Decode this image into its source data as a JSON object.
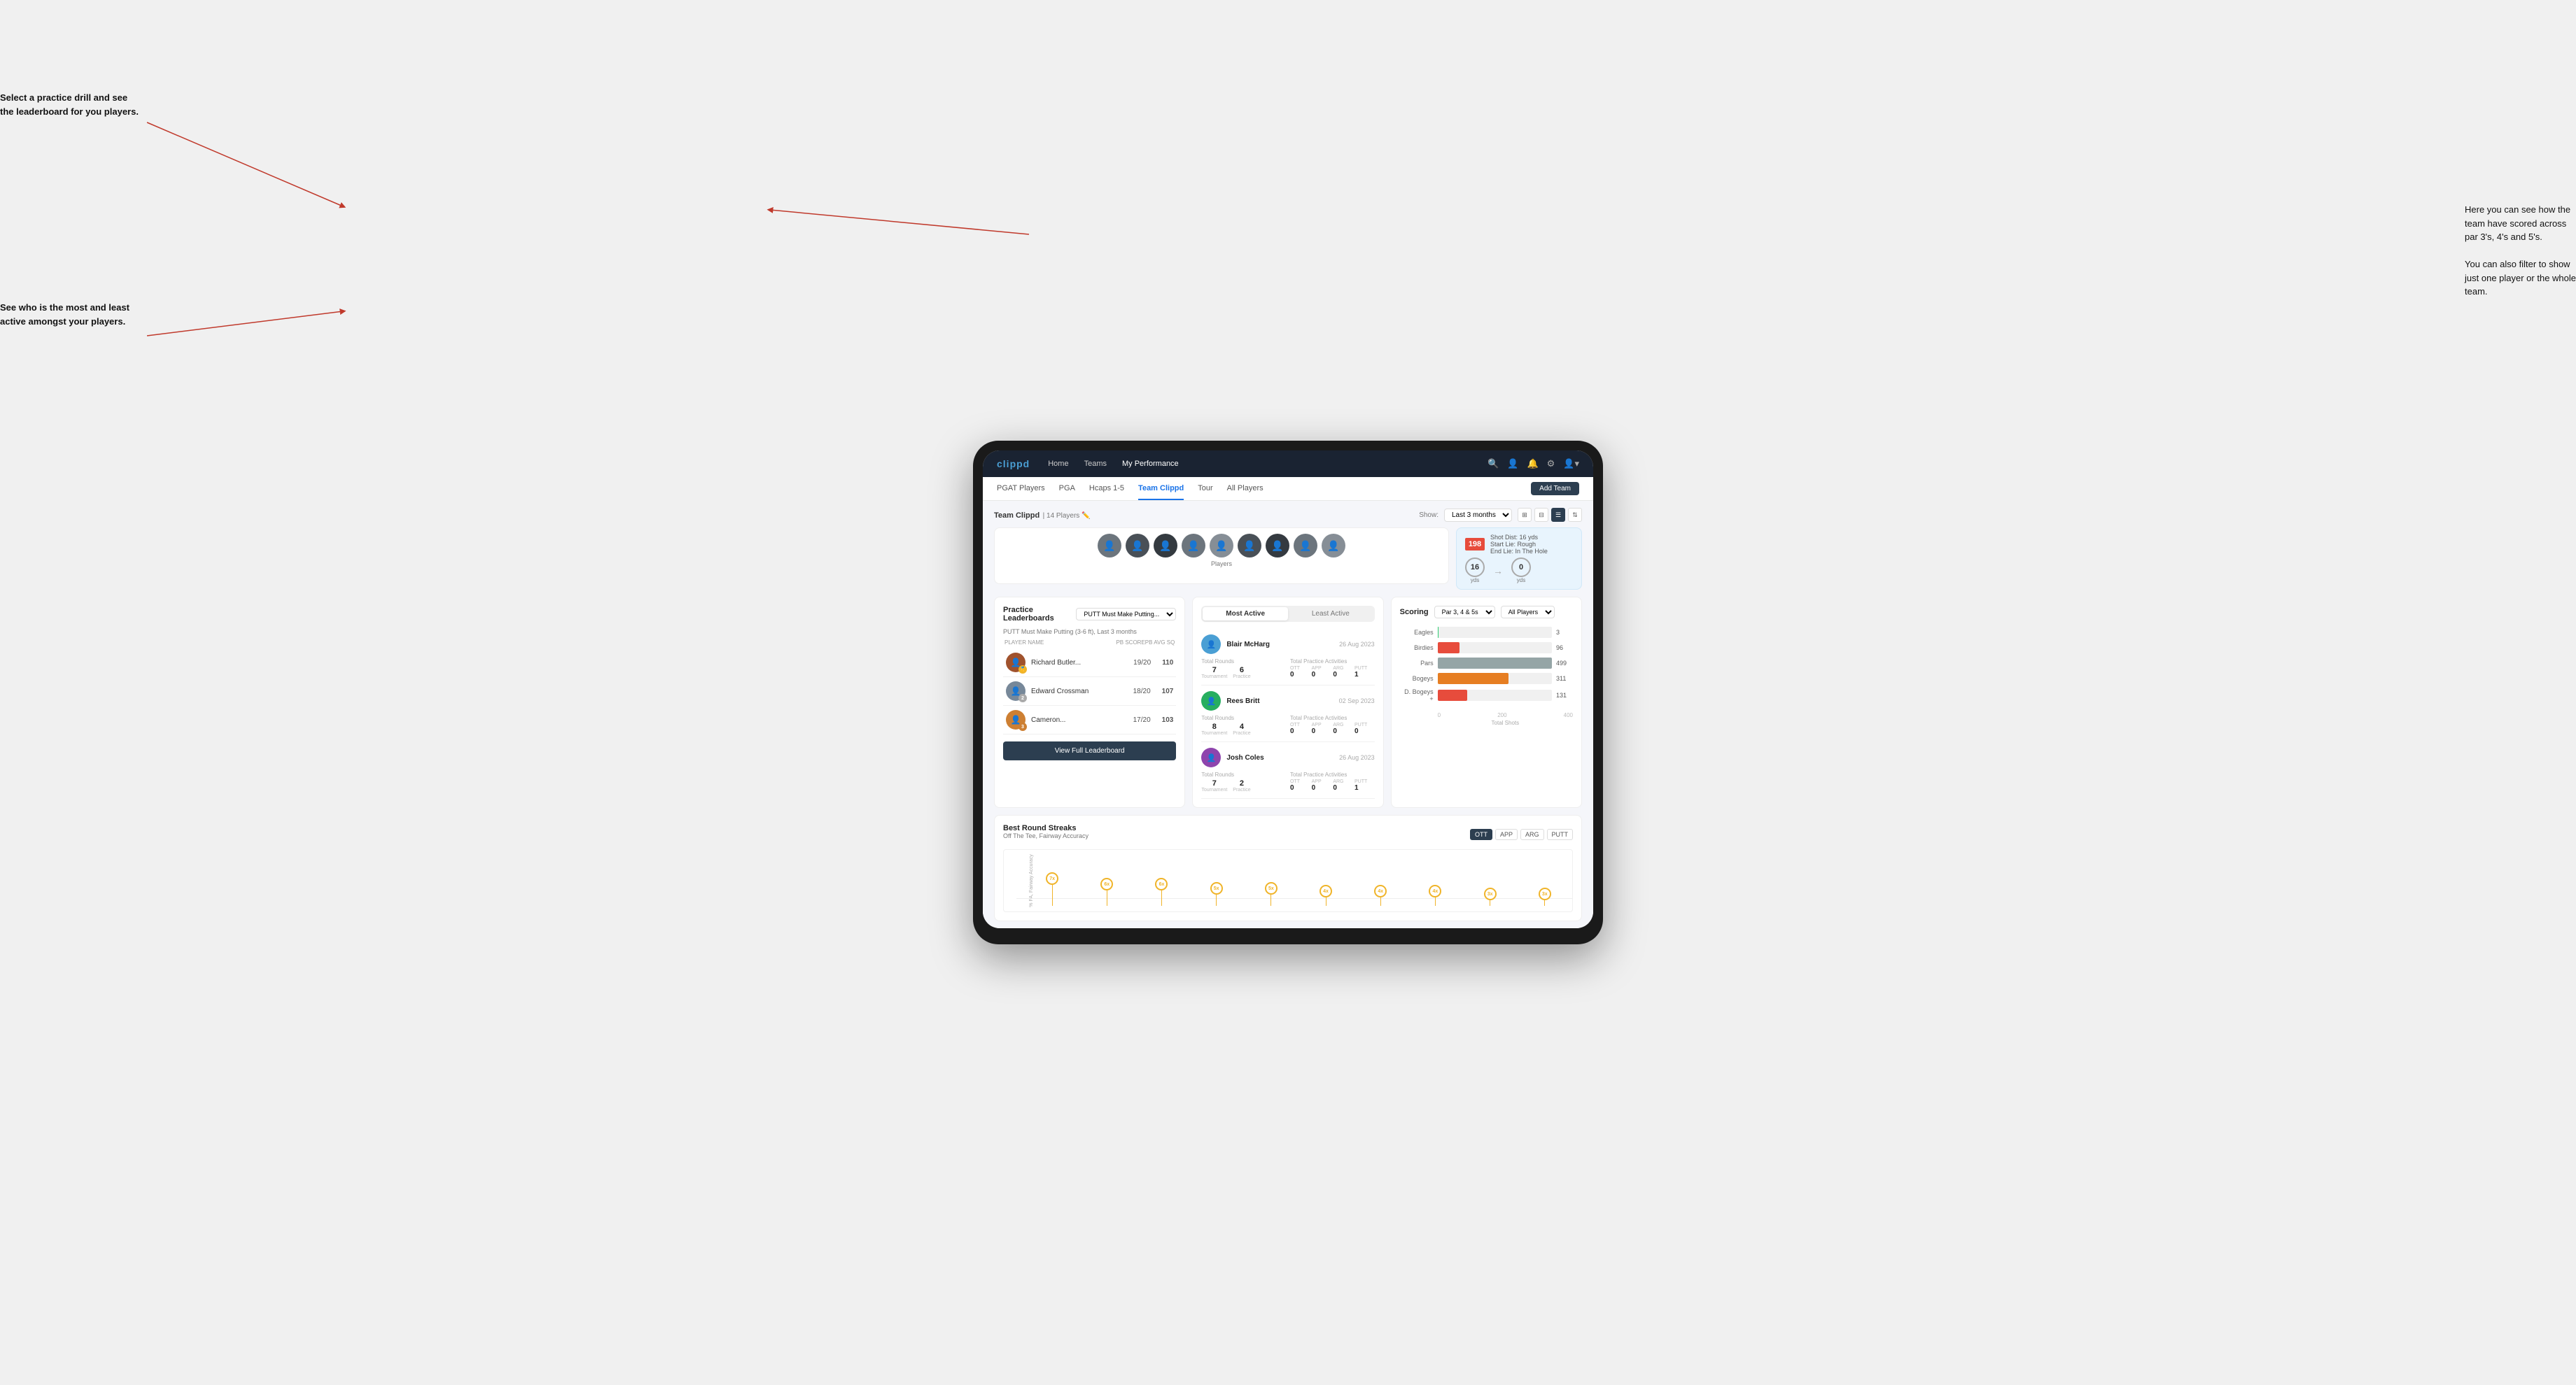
{
  "annotations": {
    "top_left": "Select a practice drill and see\nthe leaderboard for you players.",
    "bottom_left": "See who is the most and least\nactive amongst your players.",
    "top_right": "Here you can see how the\nteam have scored across\npar 3's, 4's and 5's.\n\nYou can also filter to show\njust one player or the whole\nteam."
  },
  "nav": {
    "logo": "clippd",
    "links": [
      "Home",
      "Teams",
      "My Performance"
    ],
    "icons": [
      "search",
      "person",
      "bell",
      "settings",
      "user"
    ]
  },
  "subnav": {
    "links": [
      "PGAT Players",
      "PGA",
      "Hcaps 1-5",
      "Team Clippd",
      "Tour",
      "All Players"
    ],
    "active": "Team Clippd",
    "add_team_label": "Add Team"
  },
  "team_header": {
    "title": "Team Clippd",
    "count": "14 Players",
    "show_label": "Show:",
    "show_value": "Last 3 months",
    "view_modes": [
      "grid-sm",
      "grid-lg",
      "list",
      "sort"
    ]
  },
  "players_label": "Players",
  "shot_info": {
    "dist_label": "Shot Dist: 16 yds",
    "start_label": "Start Lie: Rough",
    "end_label": "End Lie: In The Hole",
    "num": "198",
    "num_label": "SQ",
    "circle1_val": "16",
    "circle1_label": "yds",
    "circle2_val": "0",
    "circle2_label": "yds"
  },
  "practice_leaderboard": {
    "title": "Practice Leaderboards",
    "filter": "PUTT Must Make Putting...",
    "subtitle": "PUTT Must Make Putting (3-6 ft), Last 3 months",
    "col_name": "PLAYER NAME",
    "col_score": "PB SCORE",
    "col_avg": "PB AVG SQ",
    "players": [
      {
        "rank": 1,
        "name": "Richard Butler...",
        "score": "19/20",
        "avg": "110",
        "badge": "gold",
        "badge_num": ""
      },
      {
        "rank": 2,
        "name": "Edward Crossman",
        "score": "18/20",
        "avg": "107",
        "badge": "silver",
        "badge_num": "2"
      },
      {
        "rank": 3,
        "name": "Cameron...",
        "score": "17/20",
        "avg": "103",
        "badge": "bronze",
        "badge_num": "3"
      }
    ],
    "view_full_label": "View Full Leaderboard"
  },
  "active_players": {
    "tab_most": "Most Active",
    "tab_least": "Least Active",
    "active_tab": "most",
    "players": [
      {
        "name": "Blair McHarg",
        "date": "26 Aug 2023",
        "total_rounds_label": "Total Rounds",
        "tournament": "7",
        "tournament_label": "Tournament",
        "practice": "6",
        "practice_label": "Practice",
        "total_practice_label": "Total Practice Activities",
        "ott": "0",
        "app": "0",
        "arg": "0",
        "putt": "1"
      },
      {
        "name": "Rees Britt",
        "date": "02 Sep 2023",
        "total_rounds_label": "Total Rounds",
        "tournament": "8",
        "tournament_label": "Tournament",
        "practice": "4",
        "practice_label": "Practice",
        "total_practice_label": "Total Practice Activities",
        "ott": "0",
        "app": "0",
        "arg": "0",
        "putt": "0"
      },
      {
        "name": "Josh Coles",
        "date": "26 Aug 2023",
        "total_rounds_label": "Total Rounds",
        "tournament": "7",
        "tournament_label": "Tournament",
        "practice": "2",
        "practice_label": "Practice",
        "total_practice_label": "Total Practice Activities",
        "ott": "0",
        "app": "0",
        "arg": "0",
        "putt": "1"
      }
    ]
  },
  "scoring": {
    "title": "Scoring",
    "filter1": "Par 3, 4 & 5s",
    "filter2": "All Players",
    "bars": [
      {
        "label": "Eagles",
        "value": 3,
        "max": 500,
        "color": "eagles"
      },
      {
        "label": "Birdies",
        "value": 96,
        "max": 500,
        "color": "birdies"
      },
      {
        "label": "Pars",
        "value": 499,
        "max": 500,
        "color": "pars"
      },
      {
        "label": "Bogeys",
        "value": 311,
        "max": 500,
        "color": "bogeys"
      },
      {
        "label": "D. Bogeys +",
        "value": 131,
        "max": 500,
        "color": "dbogeys"
      }
    ],
    "x_ticks": [
      "0",
      "200",
      "400"
    ],
    "x_label": "Total Shots"
  },
  "streaks": {
    "title": "Best Round Streaks",
    "subtitle": "Off The Tee, Fairway Accuracy",
    "filters": [
      "OTT",
      "APP",
      "ARG",
      "PUTT"
    ],
    "active_filter": "OTT",
    "pins": [
      {
        "val": "7x",
        "pos": 8
      },
      {
        "val": "6x",
        "pos": 18
      },
      {
        "val": "6x",
        "pos": 28
      },
      {
        "val": "5x",
        "pos": 38
      },
      {
        "val": "5x",
        "pos": 47
      },
      {
        "val": "4x",
        "pos": 57
      },
      {
        "val": "4x",
        "pos": 64
      },
      {
        "val": "4x",
        "pos": 71
      },
      {
        "val": "3x",
        "pos": 80
      },
      {
        "val": "3x",
        "pos": 88
      }
    ]
  }
}
